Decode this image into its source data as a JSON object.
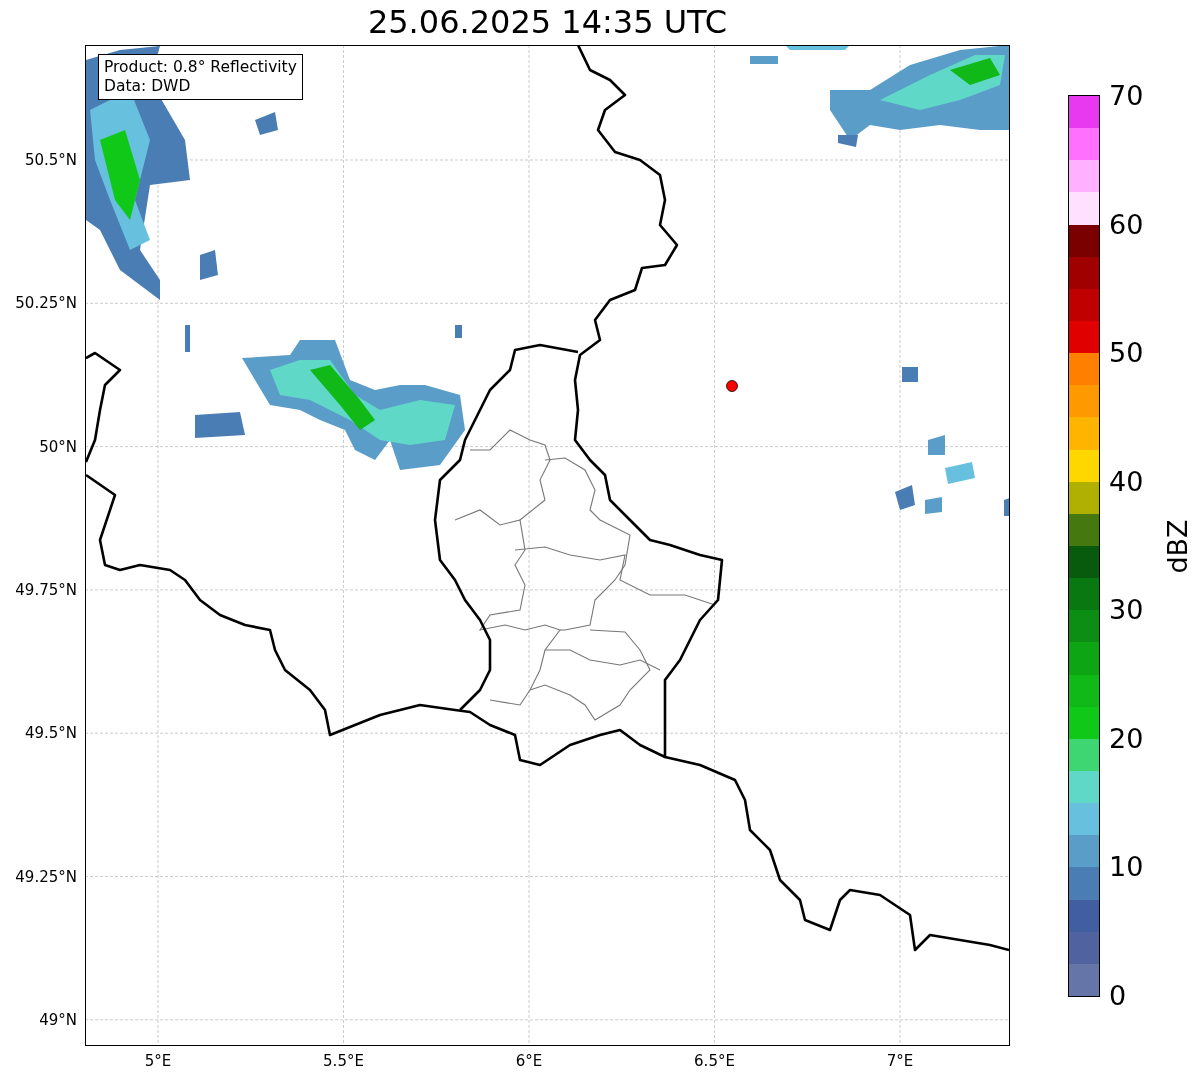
{
  "title": "25.06.2025 14:35 UTC",
  "map": {
    "legend": [
      "Product: 0.8° Reflectivity",
      "Data: DWD"
    ],
    "xticks": [
      "5°E",
      "5.5°E",
      "6°E",
      "6.5°E",
      "7°E"
    ],
    "yticks": [
      "50.5°N",
      "50.25°N",
      "50°N",
      "49.75°N",
      "49.5°N",
      "49.25°N",
      "49°N"
    ]
  },
  "colorbar": {
    "label": "dBZ",
    "ticks": [
      "70",
      "60",
      "50",
      "40",
      "30",
      "20",
      "10",
      "0"
    ],
    "segments": [
      {
        "color": "#e838f0"
      },
      {
        "color": "#ff70ff"
      },
      {
        "color": "#ffb0ff"
      },
      {
        "color": "#ffe0ff"
      },
      {
        "color": "#7a0000"
      },
      {
        "color": "#a00000"
      },
      {
        "color": "#c00000"
      },
      {
        "color": "#e00000"
      },
      {
        "color": "#ff7f00"
      },
      {
        "color": "#ff9900"
      },
      {
        "color": "#ffb400"
      },
      {
        "color": "#ffd700"
      },
      {
        "color": "#b0b000"
      },
      {
        "color": "#467810"
      },
      {
        "color": "#085a0c"
      },
      {
        "color": "#0a7810"
      },
      {
        "color": "#0c8e14"
      },
      {
        "color": "#0ea514"
      },
      {
        "color": "#10b818"
      },
      {
        "color": "#10c818"
      },
      {
        "color": "#3ed672"
      },
      {
        "color": "#5fd8c8"
      },
      {
        "color": "#66c0de"
      },
      {
        "color": "#5a9dc8"
      },
      {
        "color": "#4a7db3"
      },
      {
        "color": "#405ea0"
      },
      {
        "color": "#50629f"
      },
      {
        "color": "#6675a8"
      }
    ]
  }
}
